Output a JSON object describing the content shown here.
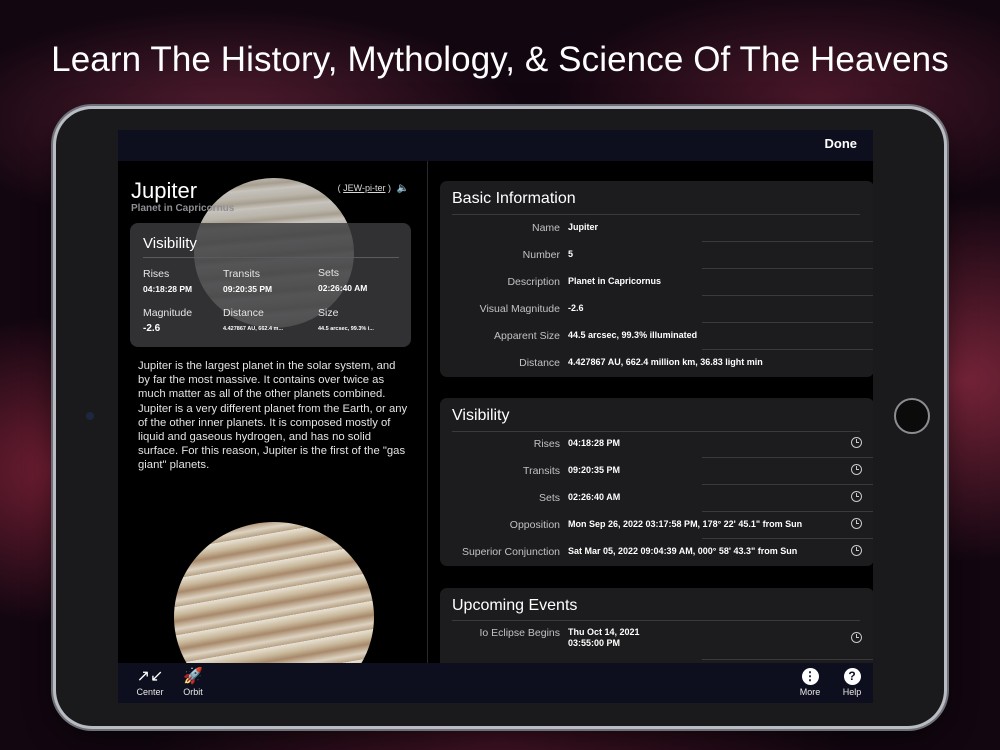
{
  "headline": "Learn The History, Mythology, & Science Of The Heavens",
  "topbar": {
    "done_label": "Done"
  },
  "left": {
    "planet_name": "Jupiter",
    "planet_subtitle": "Planet in Capricornus",
    "pron_open": "(",
    "pronunciation": "JEW-pi-ter",
    "pron_close": ")",
    "visibility": {
      "title": "Visibility",
      "rises_label": "Rises",
      "rises_value": "04:18:28 PM",
      "transits_label": "Transits",
      "transits_value": "09:20:35 PM",
      "sets_label": "Sets",
      "sets_value": "02:26:40 AM",
      "magnitude_label": "Magnitude",
      "magnitude_value": "-2.6",
      "distance_label": "Distance",
      "distance_value": "4.427867 AU, 662.4 m...",
      "size_label": "Size",
      "size_value": "44.5 arcsec, 99.3% i..."
    },
    "description": "Jupiter is the largest planet in the solar system, and by far the most massive. It contains over twice as much matter as all of the other planets combined. Jupiter is a very different planet from the Earth, or any of the other inner planets. It is composed mostly of liquid and gaseous hydrogen, and has no solid surface. For this reason, Jupiter is the first of the \"gas giant\" planets."
  },
  "basic": {
    "title": "Basic Information",
    "rows": [
      {
        "label": "Name",
        "value": "Jupiter"
      },
      {
        "label": "Number",
        "value": "5"
      },
      {
        "label": "Description",
        "value": "Planet in Capricornus"
      },
      {
        "label": "Visual Magnitude",
        "value": "-2.6"
      },
      {
        "label": "Apparent Size",
        "value": "44.5 arcsec, 99.3% illuminated"
      },
      {
        "label": "Distance",
        "value": "4.427867 AU, 662.4 million km, 36.83 light min"
      }
    ]
  },
  "visibility": {
    "title": "Visibility",
    "rows": [
      {
        "label": "Rises",
        "value": "04:18:28 PM"
      },
      {
        "label": "Transits",
        "value": "09:20:35 PM"
      },
      {
        "label": "Sets",
        "value": "02:26:40 AM"
      },
      {
        "label": "Opposition",
        "value": "Mon Sep 26, 2022  03:17:58 PM, 178° 22' 45.1\" from Sun"
      },
      {
        "label": "Superior Conjunction",
        "value": "Sat Mar 05, 2022  09:04:39 AM, 000° 58' 43.3\" from Sun"
      }
    ]
  },
  "events": {
    "title": "Upcoming Events",
    "rows": [
      {
        "label": "Io Eclipse Begins",
        "value_line1": "Thu Oct 14, 2021",
        "value_line2": "03:55:00 PM"
      }
    ]
  },
  "toolbar": {
    "center_label": "Center",
    "orbit_label": "Orbit",
    "more_label": "More",
    "help_label": "Help"
  }
}
